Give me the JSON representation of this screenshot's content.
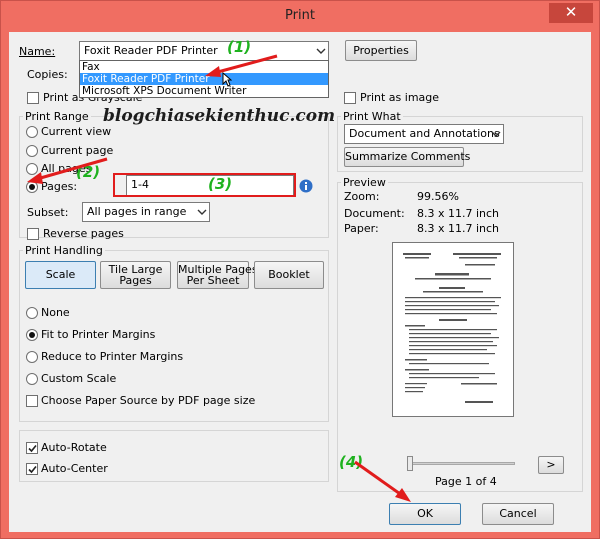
{
  "window": {
    "title": "Print",
    "close_glyph": "✕"
  },
  "printer": {
    "name_label": "Name:",
    "selected": "Foxit Reader PDF Printer",
    "options": [
      "Fax",
      "Foxit Reader PDF Printer",
      "Microsoft XPS Document Writer"
    ],
    "properties_label": "Properties",
    "copies_label": "Copies:",
    "grayscale_label": "Print as Grayscale",
    "image_label": "Print as image"
  },
  "print_range": {
    "title": "Print Range",
    "current_view": "Current view",
    "current_page": "Current page",
    "all_pages": "All pages",
    "pages_label": "Pages:",
    "pages_value": "1-4",
    "subset_label": "Subset:",
    "subset_value": "All pages in range",
    "reverse_label": "Reverse pages"
  },
  "print_what": {
    "title": "Print What",
    "value": "Document and Annotations",
    "summarize_label": "Summarize Comments"
  },
  "handling": {
    "title": "Print Handling",
    "scale_btn": "Scale",
    "tile_btn_1": "Tile Large",
    "tile_btn_2": "Pages",
    "multi_btn_1": "Multiple Pages",
    "multi_btn_2": "Per Sheet",
    "booklet_btn": "Booklet",
    "none": "None",
    "fit": "Fit to Printer Margins",
    "reduce": "Reduce to Printer Margins",
    "custom": "Custom Scale",
    "paper_source": "Choose Paper Source by PDF page size"
  },
  "auto": {
    "rotate": "Auto-Rotate",
    "center": "Auto-Center"
  },
  "preview": {
    "title": "Preview",
    "zoom_label": "Zoom:",
    "zoom_value": "99.56%",
    "document_label": "Document:",
    "document_value": "8.3 x 11.7 inch",
    "paper_label": "Paper:",
    "paper_value": "8.3 x 11.7 inch",
    "next": ">",
    "page_indicator": "Page 1 of 4"
  },
  "buttons": {
    "ok": "OK",
    "cancel": "Cancel"
  },
  "annotations": {
    "a1": "(1)",
    "a2": "(2)",
    "a3": "(3)",
    "a4": "(4)",
    "watermark": "blogchiasekienthuc.com"
  },
  "colors": {
    "frame": "#f06e62",
    "annotation": "#1fb21f",
    "arrow": "#e11c1c",
    "highlight": "#3399ff"
  }
}
